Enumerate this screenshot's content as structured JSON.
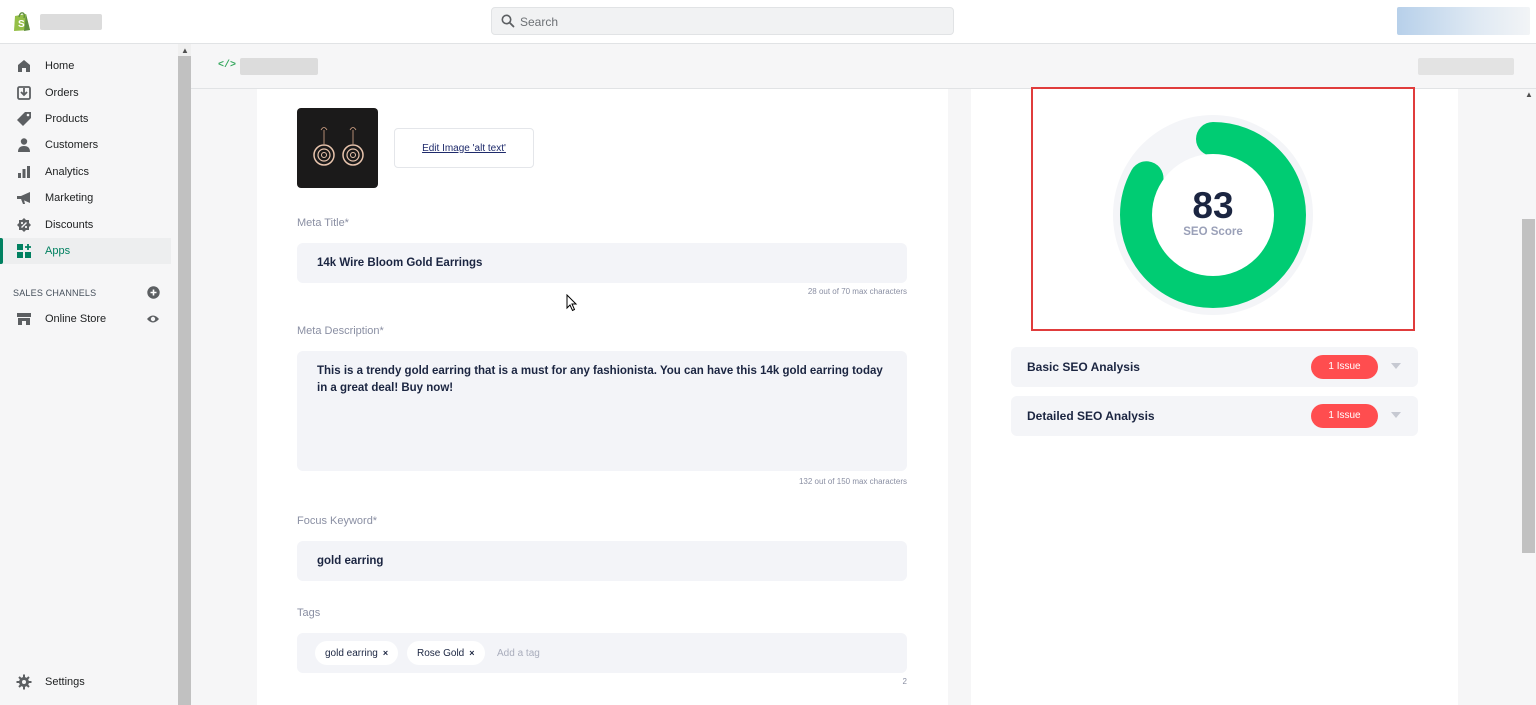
{
  "search": {
    "placeholder": "Search"
  },
  "sidebar": {
    "items": [
      {
        "label": "Home",
        "icon": "home-icon"
      },
      {
        "label": "Orders",
        "icon": "orders-icon"
      },
      {
        "label": "Products",
        "icon": "tag-icon"
      },
      {
        "label": "Customers",
        "icon": "person-icon"
      },
      {
        "label": "Analytics",
        "icon": "bar-chart-icon"
      },
      {
        "label": "Marketing",
        "icon": "megaphone-icon"
      },
      {
        "label": "Discounts",
        "icon": "discount-icon"
      },
      {
        "label": "Apps",
        "icon": "apps-icon",
        "active": true
      }
    ],
    "sales_channels_label": "SALES CHANNELS",
    "online_store_label": "Online Store",
    "settings_label": "Settings"
  },
  "app_header": {
    "icon": "code-icon"
  },
  "editor": {
    "edit_alt_label": "Edit Image 'alt text'",
    "meta_title": {
      "label": "Meta Title*",
      "value": "14k Wire Bloom Gold Earrings",
      "counter": "28 out of 70 max characters"
    },
    "meta_description": {
      "label": "Meta Description*",
      "value": "This is a trendy gold earring that is a must for any fashionista. You can have this 14k gold earring today in a great deal! Buy now!",
      "counter": "132 out of 150 max characters"
    },
    "focus_keyword": {
      "label": "Focus Keyword*",
      "value": "gold earring"
    },
    "tags": {
      "label": "Tags",
      "items": [
        "gold earring",
        "Rose Gold"
      ],
      "remove_glyph": "×",
      "placeholder": "Add a tag",
      "count": "2"
    }
  },
  "seo": {
    "score": 83,
    "score_label": "SEO Score",
    "accent": "#00cc73",
    "track": "#f4f5f8",
    "analysis": [
      {
        "title": "Basic SEO Analysis",
        "badge": "1 Issue"
      },
      {
        "title": "Detailed SEO Analysis",
        "badge": "1 Issue"
      }
    ],
    "badge_color": "#ff4d4f"
  },
  "brand": {
    "logo": "shopify-bag-icon",
    "accent": "#008060"
  }
}
